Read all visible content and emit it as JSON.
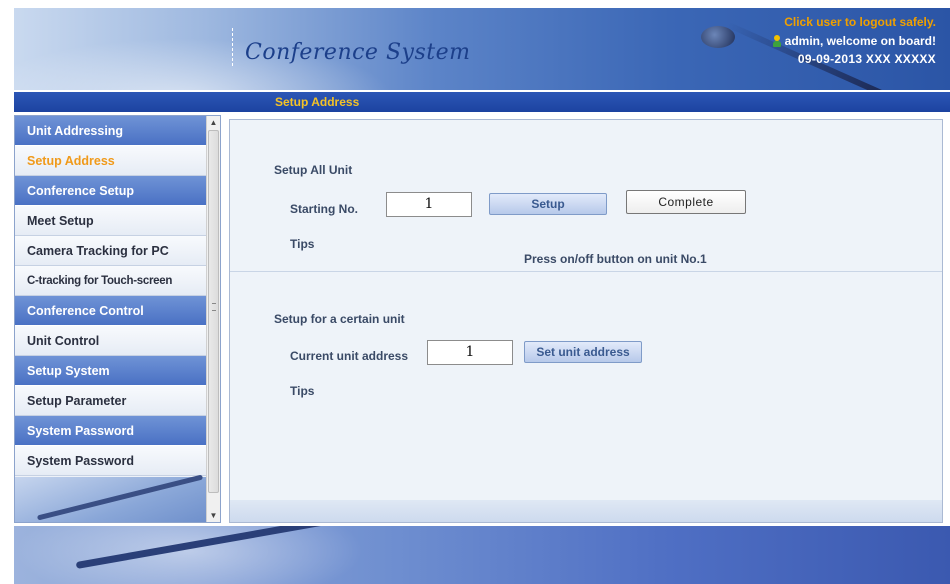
{
  "header": {
    "title": "Conference System",
    "logout_text": "Click user to logout safely.",
    "welcome_text": "admin, welcome on board!",
    "datetime": "09-09-2013 XXX XXXXX"
  },
  "breadcrumb": "Setup Address",
  "sidebar": {
    "items": [
      {
        "label": "Unit Addressing",
        "type": "group"
      },
      {
        "label": "Setup Address",
        "type": "sub",
        "active": true
      },
      {
        "label": "Conference Setup",
        "type": "group"
      },
      {
        "label": "Meet Setup",
        "type": "sub"
      },
      {
        "label": "Camera Tracking for PC",
        "type": "sub"
      },
      {
        "label": "C-tracking for Touch-screen",
        "type": "sub"
      },
      {
        "label": "Conference Control",
        "type": "group"
      },
      {
        "label": "Unit Control",
        "type": "sub"
      },
      {
        "label": "Setup System",
        "type": "group"
      },
      {
        "label": "Setup Parameter",
        "type": "sub"
      },
      {
        "label": "System Password",
        "type": "group"
      },
      {
        "label": "System Password",
        "type": "sub"
      }
    ]
  },
  "setup_all": {
    "section_title": "Setup All Unit",
    "starting_label": "Starting No.",
    "starting_value": "1",
    "setup_button": "Setup",
    "complete_button": "Complete",
    "tips_label": "Tips",
    "tips_text": "Press on/off button on unit No.1"
  },
  "setup_certain": {
    "section_title": "Setup for a certain unit",
    "current_label": "Current unit address",
    "current_value": "1",
    "set_button": "Set unit address",
    "tips_label": "Tips"
  },
  "colors": {
    "accent_orange": "#f09a1a",
    "nav_blue": "#4a71c4",
    "bar_blue": "#1c43a0"
  }
}
